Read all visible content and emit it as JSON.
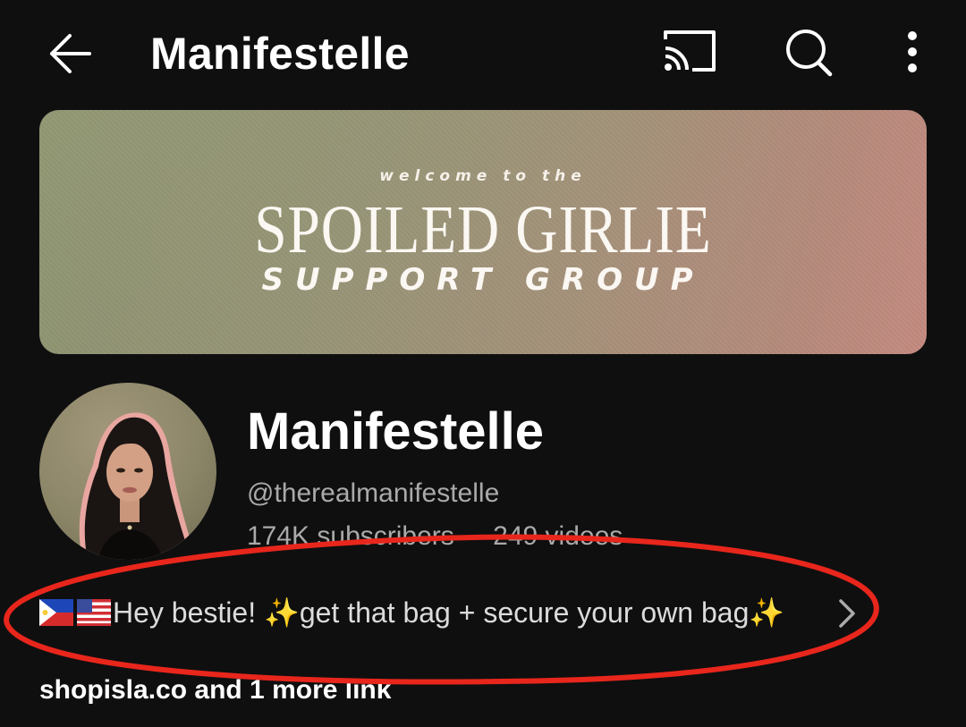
{
  "appbar": {
    "title": "Manifestelle"
  },
  "banner": {
    "line1": "welcome to the",
    "line2": "SPOILED GIRLIE",
    "line3": "SUPPORT GROUP"
  },
  "channel": {
    "name": "Manifestelle",
    "handle": "@therealmanifestelle",
    "subscribers": "174K subscribers",
    "separator": "·",
    "videos": "249 videos",
    "description": "Hey bestie! ✨get that bag + secure your own bag✨",
    "links": "shopisla.co and 1 more link"
  },
  "icons": [
    "back-arrow-icon",
    "cast-icon",
    "search-icon",
    "more-vert-icon",
    "philippines-flag-icon",
    "us-flag-icon",
    "sparkles-icon",
    "chevron-right-icon"
  ],
  "colors": {
    "background": "#0f0f0f",
    "primary_text": "#ffffff",
    "secondary_text": "#aaaaaa",
    "annotation": "#e8261c"
  }
}
